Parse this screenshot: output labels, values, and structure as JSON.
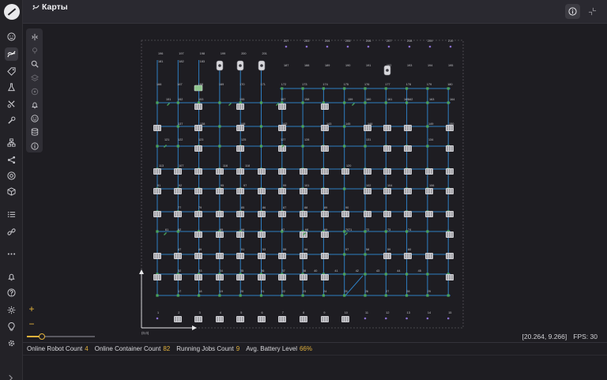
{
  "header": {
    "title": "Карты"
  },
  "map": {
    "origin_label": "(0,0)",
    "cursor": "[20.264, 9.266]",
    "fps_label": "FPS:",
    "fps": "30",
    "colors": {
      "path": "#2e7fc3",
      "node": "#4aa35a",
      "container": "#cfcfd4",
      "charger": "#8a6fd1",
      "robot": "#d8d8dc"
    },
    "node_numbers": {
      "row_0": [
        "207",
        "203",
        "204",
        "205",
        "206",
        "207",
        "208",
        "209",
        "210"
      ],
      "row_1": [
        "196",
        "197",
        "198",
        "199",
        "200",
        "201"
      ],
      "row_1b": [
        "181",
        "182",
        "183"
      ],
      "row_2": [
        "187",
        "188",
        "189",
        "190",
        "191",
        "192",
        "193",
        "194",
        "195"
      ],
      "row_3": [
        "166",
        "167",
        "168",
        "169",
        "170",
        "171",
        "172",
        "173",
        "174",
        "175",
        "176",
        "177",
        "178",
        "179",
        "180"
      ],
      "row_4": [
        "151",
        "152",
        "153",
        "155",
        "157",
        "158",
        "159",
        "160",
        "161",
        "162",
        "163",
        "164",
        "165"
      ],
      "row_5": [
        "137",
        "138",
        "148",
        "142",
        "143",
        "145",
        "146",
        "149",
        "150"
      ],
      "row_6": [
        "121",
        "122",
        "123",
        "125",
        "127",
        "128",
        "131",
        "134"
      ],
      "row_7": [
        "113",
        "107",
        "116",
        "118",
        "120"
      ],
      "row_8": [
        "91",
        "92",
        "95",
        "97",
        "99",
        "101",
        "102",
        "104",
        "106"
      ],
      "row_9": [
        "77",
        "79",
        "85",
        "86",
        "87",
        "88",
        "89",
        "90"
      ],
      "row_10": [
        "61",
        "62",
        "65",
        "66",
        "67",
        "68",
        "69",
        "70",
        "71",
        "72",
        "73",
        "74"
      ],
      "row_11": [
        "47",
        "49",
        "51",
        "53",
        "55",
        "56",
        "57",
        "58",
        "59",
        "60"
      ],
      "row_12": [
        "32",
        "33",
        "34",
        "35",
        "36",
        "37",
        "38",
        "40",
        "41",
        "42",
        "43",
        "44",
        "45"
      ],
      "row_13": [
        "17",
        "18",
        "19",
        "20",
        "21",
        "22",
        "23",
        "24",
        "25",
        "26",
        "27",
        "28",
        "29"
      ],
      "row_14": [
        "1",
        "2",
        "3",
        "4",
        "5",
        "6",
        "7",
        "8",
        "9",
        "10",
        "11",
        "12",
        "13",
        "14",
        "15"
      ]
    }
  },
  "zoom": {
    "in": "+",
    "out": "−",
    "level": 0.22
  },
  "status": {
    "robot_label": "Online Robot Count",
    "robot_value": "4",
    "container_label": "Online Container Count",
    "container_value": "82",
    "jobs_label": "Running Jobs Count",
    "jobs_value": "9",
    "battery_label": "Avg. Battery Level",
    "battery_value": "66%"
  },
  "rail_icons": [
    "smile-icon",
    "route-icon",
    "tag-icon",
    "flask-icon",
    "tools-icon",
    "wrench-icon",
    "hierarchy-icon",
    "share-icon",
    "target-icon",
    "cube-icon",
    "list-icon",
    "link-icon",
    "more-icon",
    "bell-icon",
    "help-icon",
    "settings-icon",
    "bulb-icon",
    "gear-icon"
  ],
  "tool_icons": [
    "swap-icon",
    "pin-icon",
    "zoom-icon",
    "layers-icon",
    "circle-icon",
    "bell-icon",
    "smile-icon",
    "database-icon",
    "info-icon"
  ]
}
